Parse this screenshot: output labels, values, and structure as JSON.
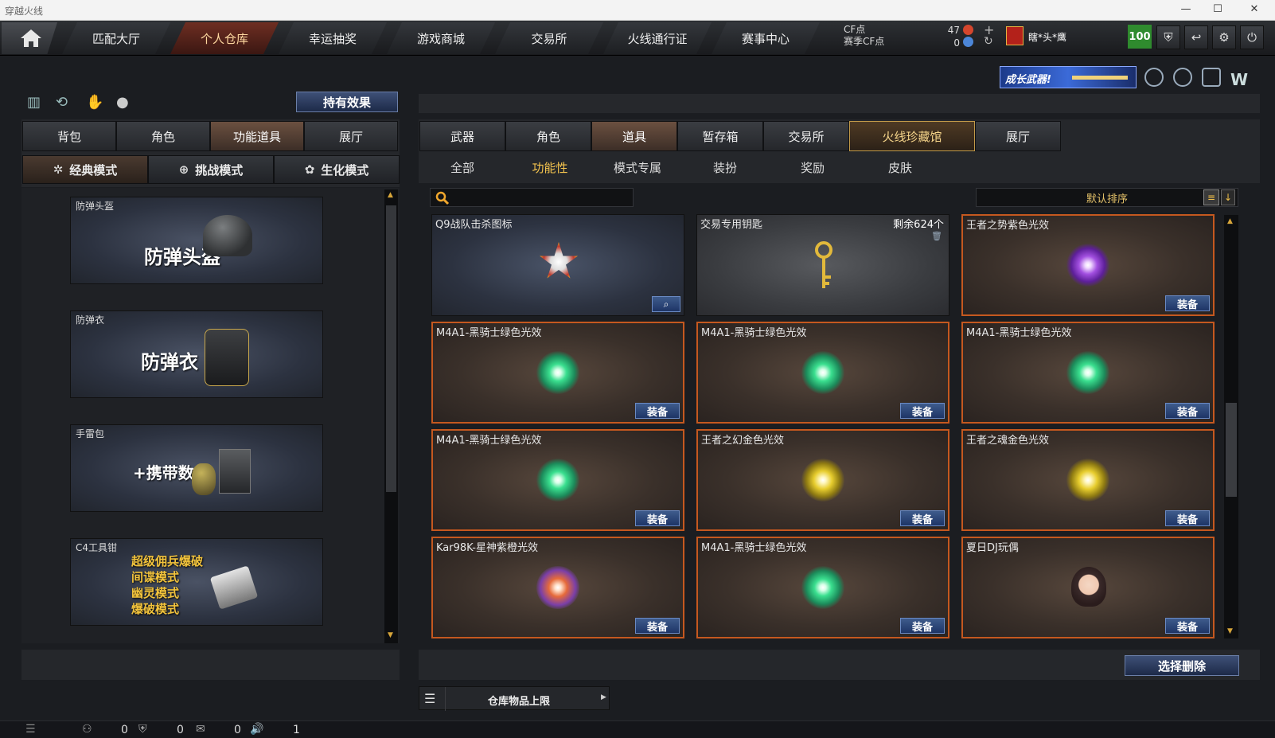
{
  "window": {
    "title": "穿越火线",
    "minimize": "—",
    "maximize": "☐",
    "close": "✕"
  },
  "nav": {
    "items": [
      "匹配大厅",
      "个人仓库",
      "幸运抽奖",
      "游戏商城",
      "交易所",
      "火线通行证",
      "赛事中心"
    ],
    "active_index": 1
  },
  "currency": {
    "cf_label": "CF点",
    "season_label": "赛季CF点",
    "cf_value": "47",
    "season_value": "0"
  },
  "user": {
    "name": "瞎*头*鹰",
    "level_badge": "100"
  },
  "banner": {
    "text": "成长武器!"
  },
  "left": {
    "hold_effect": "持有效果",
    "tabs": [
      "背包",
      "角色",
      "功能道具",
      "展厅"
    ],
    "active_tab": 2,
    "modes": [
      "经典模式",
      "挑战模式",
      "生化模式"
    ],
    "active_mode": 0,
    "slots": [
      {
        "title": "防弹头盔",
        "text": "防弹头盔"
      },
      {
        "title": "防弹衣",
        "text": "防弹衣"
      },
      {
        "title": "手雷包",
        "text": "+携带数"
      },
      {
        "title": "C4工具钳",
        "lines": [
          "超级佣兵爆破",
          "间谍模式",
          "幽灵模式",
          "爆破模式"
        ]
      }
    ]
  },
  "right": {
    "tabs": [
      "武器",
      "角色",
      "道具",
      "暂存箱",
      "交易所",
      "火线珍藏馆",
      "展厅"
    ],
    "active_tab": 2,
    "highlight_tab": 5,
    "subtabs": [
      "全部",
      "功能性",
      "模式专属",
      "装扮",
      "奖励",
      "皮肤"
    ],
    "active_subtab": 1,
    "search_placeholder": "",
    "sort_label": "默认排序",
    "equip_label": "装备",
    "items": [
      {
        "name": "Q9战队击杀图标",
        "kind": "skull",
        "extra": ""
      },
      {
        "name": "交易专用钥匙",
        "kind": "key",
        "extra": "剩余624个"
      },
      {
        "name": "王者之势紫色光效",
        "kind": "purple",
        "extra": ""
      },
      {
        "name": "M4A1-黑骑士绿色光效",
        "kind": "green",
        "extra": ""
      },
      {
        "name": "M4A1-黑骑士绿色光效",
        "kind": "green",
        "extra": ""
      },
      {
        "name": "M4A1-黑骑士绿色光效",
        "kind": "green",
        "extra": ""
      },
      {
        "name": "M4A1-黑骑士绿色光效",
        "kind": "green",
        "extra": ""
      },
      {
        "name": "王者之幻金色光效",
        "kind": "gold",
        "extra": ""
      },
      {
        "name": "王者之魂金色光效",
        "kind": "gold",
        "extra": ""
      },
      {
        "name": "Kar98K-星神紫橙光效",
        "kind": "orange",
        "extra": ""
      },
      {
        "name": "M4A1-黑骑士绿色光效",
        "kind": "green",
        "extra": ""
      },
      {
        "name": "夏日DJ玩偶",
        "kind": "doll",
        "extra": ""
      }
    ],
    "select_delete": "选择删除",
    "storage_limit": "仓库物品上限"
  },
  "status": {
    "values": [
      "0",
      "0",
      "0",
      "1"
    ]
  }
}
